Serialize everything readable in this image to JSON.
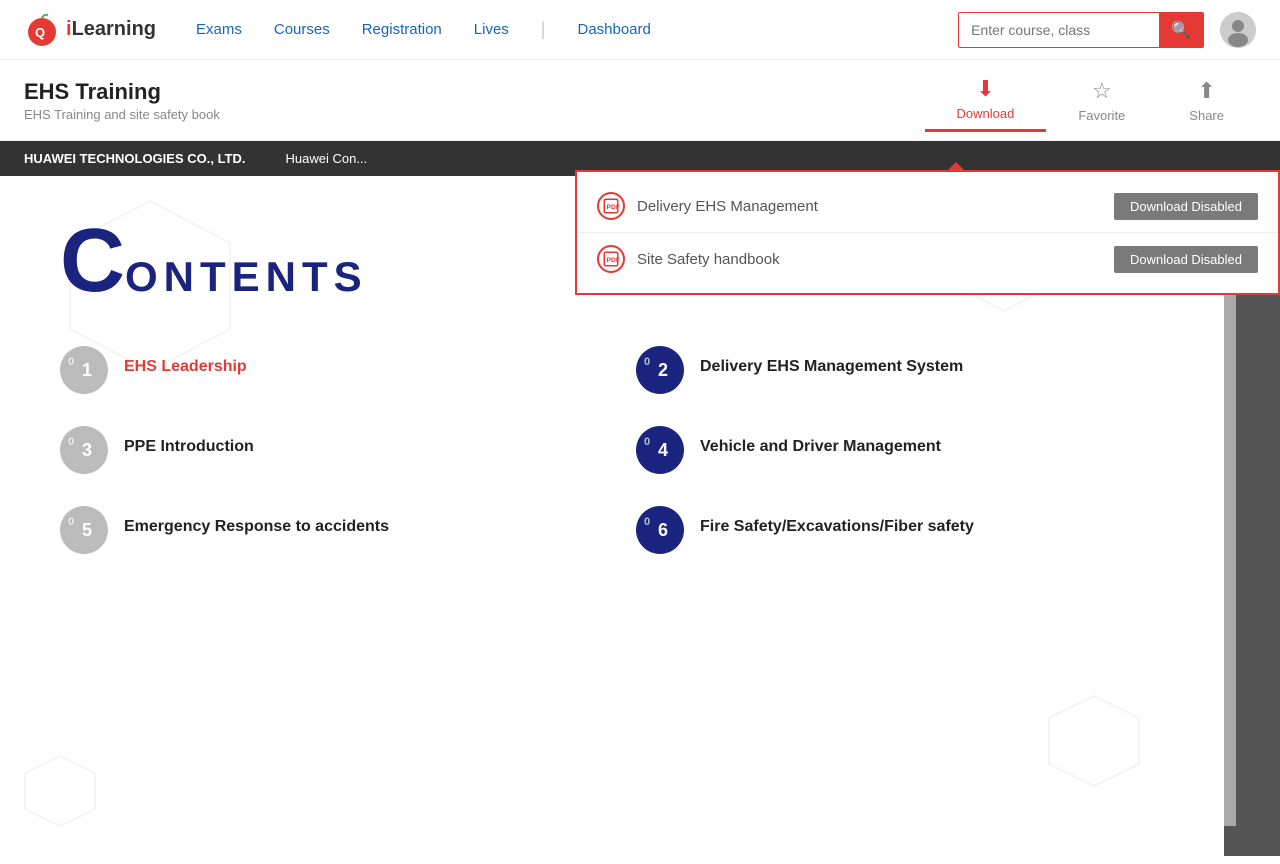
{
  "header": {
    "logo_text": "iLearning",
    "nav_items": [
      "Exams",
      "Courses",
      "Registration",
      "Lives",
      "Dashboard"
    ],
    "search_placeholder": "Enter course, class"
  },
  "toolbar": {
    "book_title": "EHS Training",
    "book_subtitle": "EHS Training and site safety book",
    "actions": [
      {
        "id": "download",
        "label": "Download",
        "active": true
      },
      {
        "id": "favorite",
        "label": "Favorite",
        "active": false
      },
      {
        "id": "share",
        "label": "Share",
        "active": false
      }
    ]
  },
  "dropdown": {
    "items": [
      {
        "name": "Delivery EHS Management",
        "btn_label": "Download Disabled"
      },
      {
        "name": "Site Safety handbook",
        "btn_label": "Download Disabled"
      }
    ]
  },
  "company_bar": {
    "company": "HUAWEI TECHNOLOGIES CO., LTD.",
    "extra": "Huawei Con..."
  },
  "contents": {
    "title_big": "C",
    "title_rest": "ONTENTS",
    "items": [
      {
        "num": "1",
        "text": "EHS Leadership",
        "style": "red"
      },
      {
        "num": "2",
        "text": "Delivery EHS Management System",
        "style": "dark"
      },
      {
        "num": "3",
        "text": "PPE Introduction",
        "style": "dark"
      },
      {
        "num": "4",
        "text": "Vehicle and Driver Management",
        "style": "dark"
      },
      {
        "num": "5",
        "text": "Emergency Response to accidents",
        "style": "dark"
      },
      {
        "num": "6",
        "text": "Fire Safety/Excavations/Fiber safety",
        "style": "dark"
      }
    ]
  },
  "icons": {
    "search": "🔍",
    "download_arrow": "⬇",
    "star": "☆",
    "share": "⬆",
    "pdf": "P",
    "lock": "🔒"
  }
}
